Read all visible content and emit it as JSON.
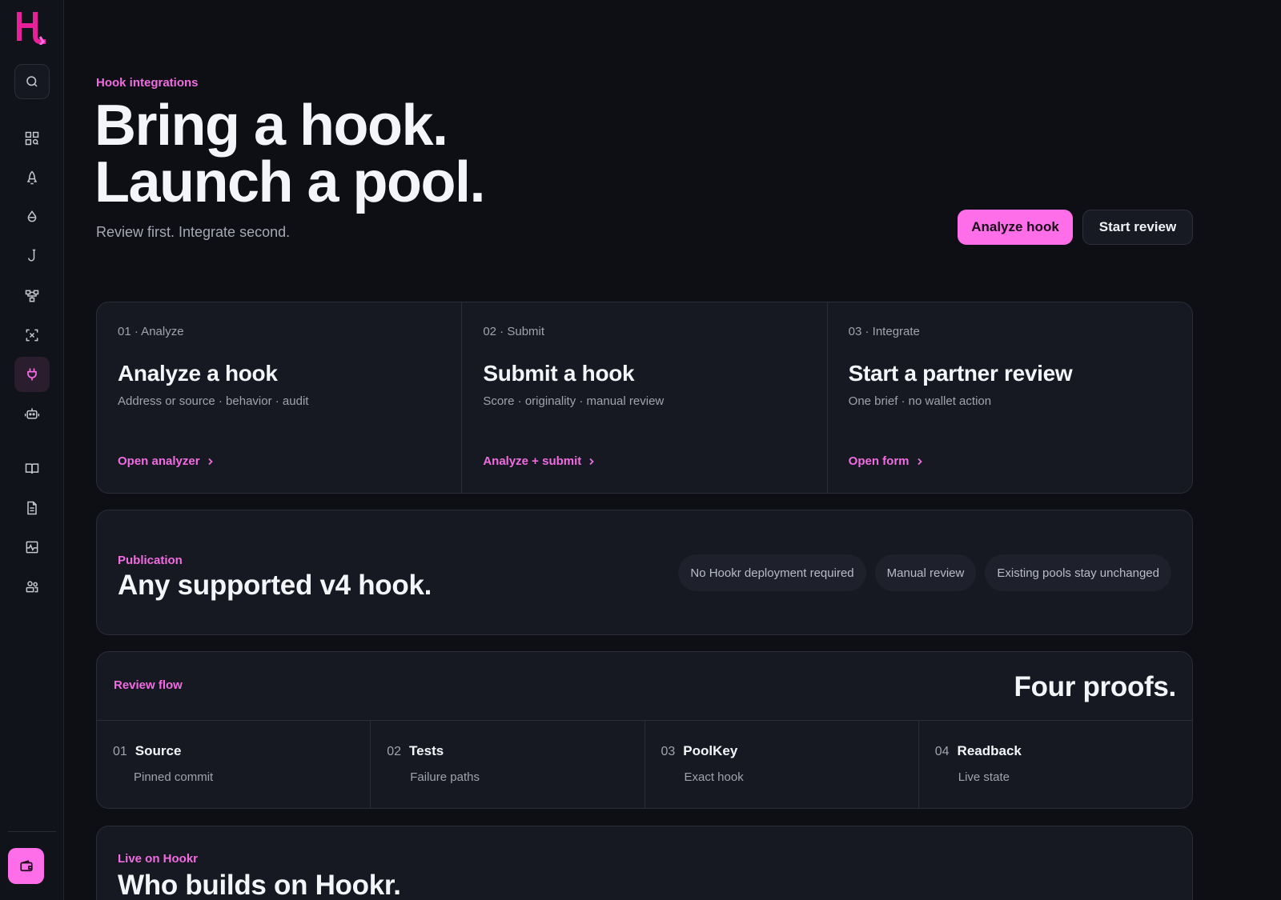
{
  "colors": {
    "accent": "#ff6ee9",
    "accent_text": "#f06ce0",
    "background": "#0d0f15",
    "card": "#161922"
  },
  "sidebar": {
    "logo": "H",
    "icons": [
      "search-icon",
      "grid-search-icon",
      "rocket-icon",
      "droplet-icon",
      "hook-icon",
      "network-icon",
      "scan-icon",
      "plug-icon",
      "robot-icon",
      "book-icon",
      "document-icon",
      "activity-icon",
      "users-icon",
      "wallet-icon"
    ],
    "active": "plug-icon"
  },
  "hero": {
    "eyebrow": "Hook integrations",
    "title_line1": "Bring a hook.",
    "title_line2": "Launch a pool.",
    "subtitle": "Review first. Integrate second.",
    "primary_button": "Analyze hook",
    "secondary_button": "Start review"
  },
  "steps": [
    {
      "kicker": "01 · Analyze",
      "title": "Analyze a hook",
      "desc": "Address or source · behavior · audit",
      "link": "Open analyzer"
    },
    {
      "kicker": "02 · Submit",
      "title": "Submit a hook",
      "desc": "Score · originality · manual review",
      "link": "Analyze + submit"
    },
    {
      "kicker": "03 · Integrate",
      "title": "Start a partner review",
      "desc": "One brief · no wallet action",
      "link": "Open form"
    }
  ],
  "publication": {
    "eyebrow": "Publication",
    "title": "Any supported v4 hook.",
    "chips": [
      "No Hookr deployment required",
      "Manual review",
      "Existing pools stay unchanged"
    ]
  },
  "review_flow": {
    "eyebrow": "Review flow",
    "title": "Four proofs.",
    "items": [
      {
        "num": "01",
        "name": "Source",
        "detail": "Pinned commit"
      },
      {
        "num": "02",
        "name": "Tests",
        "detail": "Failure paths"
      },
      {
        "num": "03",
        "name": "PoolKey",
        "detail": "Exact hook"
      },
      {
        "num": "04",
        "name": "Readback",
        "detail": "Live state"
      }
    ]
  },
  "live": {
    "eyebrow": "Live on Hookr",
    "title": "Who builds on Hookr."
  }
}
